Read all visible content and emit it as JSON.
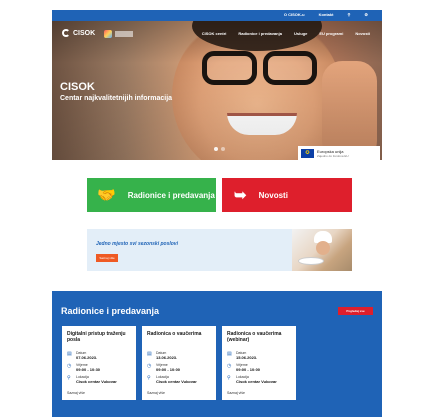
{
  "topbar": {
    "links": [
      "O CISOK-u",
      "Kontakt"
    ],
    "search_icon": "search-icon",
    "settings_icon": "gear-icon"
  },
  "hero": {
    "logo_text": "CISOK",
    "nav": [
      "CISOK centri",
      "Radionice i predavanja",
      "Usluge",
      "EU programi",
      "Novosti"
    ],
    "title": "CISOK",
    "subtitle": "Centar najkvalitetnijih informacija",
    "eu": {
      "line1": "Europska unija",
      "line2": "Zajedno do fondova EU"
    }
  },
  "tiles": [
    {
      "label": "Radionice i predavanja",
      "icon": "handshake-icon",
      "color": "#36b24b"
    },
    {
      "label": "Novosti",
      "icon": "megaphone-icon",
      "color": "#de1f2c"
    }
  ],
  "promo": {
    "text": "Jedno mjesto svi sezonski poslovi",
    "button": "Saznaj više"
  },
  "events": {
    "title": "Radionice i predavanja",
    "all_button": "Pogledaj sve",
    "cards": [
      {
        "title": "Digitalni pristup traženju posla",
        "date_label": "Datum",
        "date": "07.06.2023.",
        "time_label": "Vrijeme",
        "time": "09:00 - 10:30",
        "loc_label": "Lokacija",
        "loc": "Cisok centar Vukovar",
        "more": "Saznaj više"
      },
      {
        "title": "Radionica o vaučerima",
        "date_label": "Datum",
        "date": "13.06.2023.",
        "time_label": "Vrijeme",
        "time": "09:00 - 10:00",
        "loc_label": "Lokacija",
        "loc": "Cisok centar Vukovar",
        "more": "Saznaj više"
      },
      {
        "title": "Radionica o vaučerima (webinar)",
        "date_label": "Datum",
        "date": "15.06.2023.",
        "time_label": "Vrijeme",
        "time": "09:00 - 10:00",
        "loc_label": "Lokacija",
        "loc": "Cisok centar Vukovar",
        "more": "Saznaj više"
      }
    ]
  },
  "colors": {
    "primary_blue": "#1f63b6",
    "green": "#36b24b",
    "red": "#de1f2c",
    "orange": "#ef5a24"
  }
}
